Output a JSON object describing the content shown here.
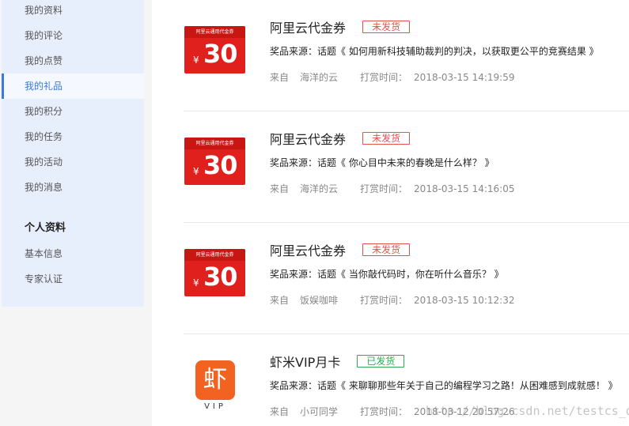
{
  "sidebar": {
    "items": [
      {
        "label": "我的资料"
      },
      {
        "label": "我的评论"
      },
      {
        "label": "我的点赞"
      },
      {
        "label": "我的礼品"
      },
      {
        "label": "我的积分"
      },
      {
        "label": "我的任务"
      },
      {
        "label": "我的活动"
      },
      {
        "label": "我的消息"
      }
    ],
    "section2_title": "个人资料",
    "section2_items": [
      {
        "label": "基本信息"
      },
      {
        "label": "专家认证"
      }
    ]
  },
  "labels": {
    "source_prefix": "奖品来源：话题",
    "from_prefix": "来自",
    "time_prefix": "打赏时间："
  },
  "coupon": {
    "band_text": "阿里云通用代金券",
    "yen": "¥",
    "amount": "30"
  },
  "vip_logo": {
    "glyph": "虾",
    "text": "VIP"
  },
  "gifts": [
    {
      "title": "阿里云代金券",
      "status": "未发货",
      "topic": "《 如何用新科技辅助裁判的判决，以获取更公平的竞赛结果 》",
      "from": "海洋的云",
      "time": "2018-03-15 14:19:59"
    },
    {
      "title": "阿里云代金券",
      "status": "未发货",
      "topic": "《 你心目中未来的春晚是什么样？ 》",
      "from": "海洋的云",
      "time": "2018-03-15 14:16:05"
    },
    {
      "title": "阿里云代金券",
      "status": "未发货",
      "topic": "《 当你敲代码时，你在听什么音乐？ 》",
      "from": "饭娱咖啡",
      "time": "2018-03-15 10:12:32"
    },
    {
      "title": "虾米VIP月卡",
      "status": "已发货",
      "topic": "《 来聊聊那些年关于自己的编程学习之路！从困难感到成就感！ 》",
      "from": "小可同学",
      "time": "2018-03-12 20:57:26"
    }
  ],
  "watermark": "http://blog.csdn.net/testcs_dn"
}
